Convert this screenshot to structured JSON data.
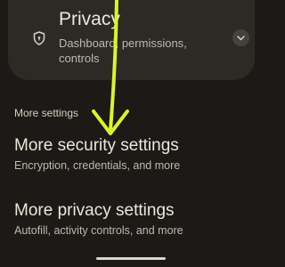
{
  "privacy_card": {
    "title": "Privacy",
    "description": "Dashboard, permissions, controls"
  },
  "section_header": "More settings",
  "items": [
    {
      "title": "More security settings",
      "subtitle": "Encryption, credentials, and more"
    },
    {
      "title": "More privacy settings",
      "subtitle": "Autofill, activity controls, and more"
    }
  ],
  "colors": {
    "background": "#1b1a17",
    "card": "#2c2a25",
    "annotation_arrow": "#d9f52a"
  },
  "icons": {
    "privacy": "shield-icon",
    "expand": "chevron-down-icon"
  }
}
